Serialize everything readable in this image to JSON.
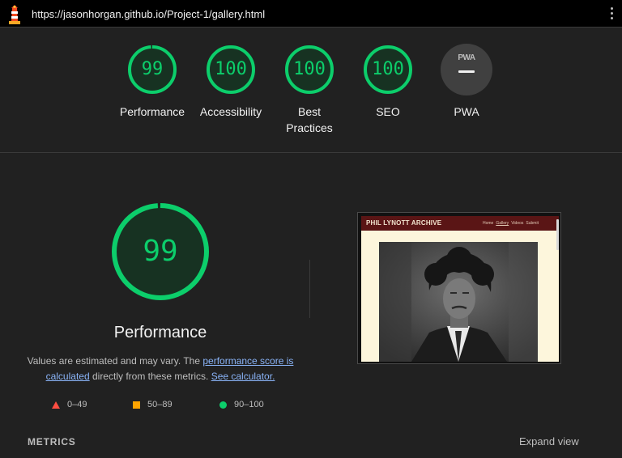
{
  "browser": {
    "url": "https://jasonhorgan.github.io/Project-1/gallery.html",
    "logo_icon": "lighthouse-icon",
    "menu_icon": "kebab-menu-icon"
  },
  "colors": {
    "pass": "#0cce6b",
    "average": "#ffa400",
    "fail": "#ff4e42",
    "link": "#8ab4f8"
  },
  "gauges": [
    {
      "score": "99",
      "label": "Performance"
    },
    {
      "score": "100",
      "label": "Accessibility"
    },
    {
      "score": "100",
      "label_line1": "Best",
      "label_line2": "Practices"
    },
    {
      "score": "100",
      "label": "SEO"
    }
  ],
  "pwa": {
    "badge": "PWA",
    "label": "PWA",
    "score": "–"
  },
  "performance": {
    "score": "99",
    "score_fraction": 0.99,
    "title": "Performance",
    "desc_before": "Values are estimated and may vary. The ",
    "desc_link1": "performance score is calculated",
    "desc_middle": " directly from these metrics. ",
    "desc_link2": "See calculator."
  },
  "legend": [
    {
      "range": "0–49",
      "shape": "triangle"
    },
    {
      "range": "50–89",
      "shape": "square"
    },
    {
      "range": "90–100",
      "shape": "circle"
    }
  ],
  "preview": {
    "site_title": "PHIL LYNOTT ARCHIVE",
    "nav": [
      "Home",
      "Gallery",
      "Videos",
      "Submit"
    ]
  },
  "footer": {
    "metrics_label": "METRICS",
    "expand_label": "Expand view"
  }
}
